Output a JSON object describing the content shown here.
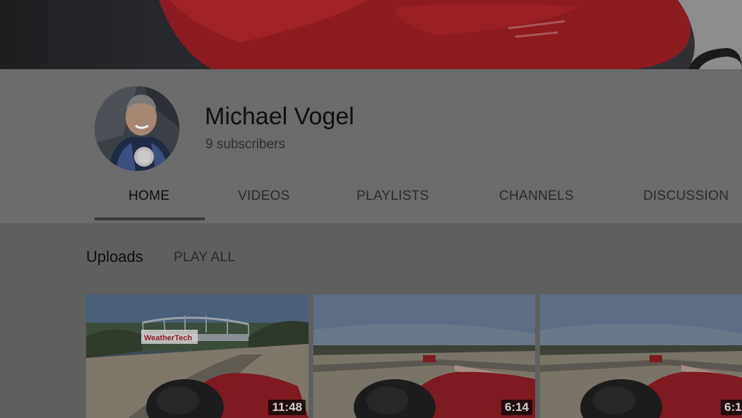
{
  "channel": {
    "name": "Michael Vogel",
    "subscribers": "9 subscribers"
  },
  "tabs": [
    {
      "label": "HOME",
      "active": true
    },
    {
      "label": "VIDEOS",
      "active": false
    },
    {
      "label": "PLAYLISTS",
      "active": false
    },
    {
      "label": "CHANNELS",
      "active": false
    },
    {
      "label": "DISCUSSION",
      "active": false
    }
  ],
  "uploads": {
    "title": "Uploads",
    "play_all": "PLAY ALL",
    "videos": [
      {
        "duration": "11:48",
        "bridge_sign": "WeatherTech"
      },
      {
        "duration": "6:14"
      },
      {
        "duration": "6:1"
      }
    ]
  },
  "colors": {
    "overlay_tint": "#6b6b6b",
    "active_tab_underline": "#383838",
    "banner_car_red": "#8e1c22"
  },
  "icons": [
    "avatar-photo",
    "banner-image",
    "video-thumbnail"
  ]
}
